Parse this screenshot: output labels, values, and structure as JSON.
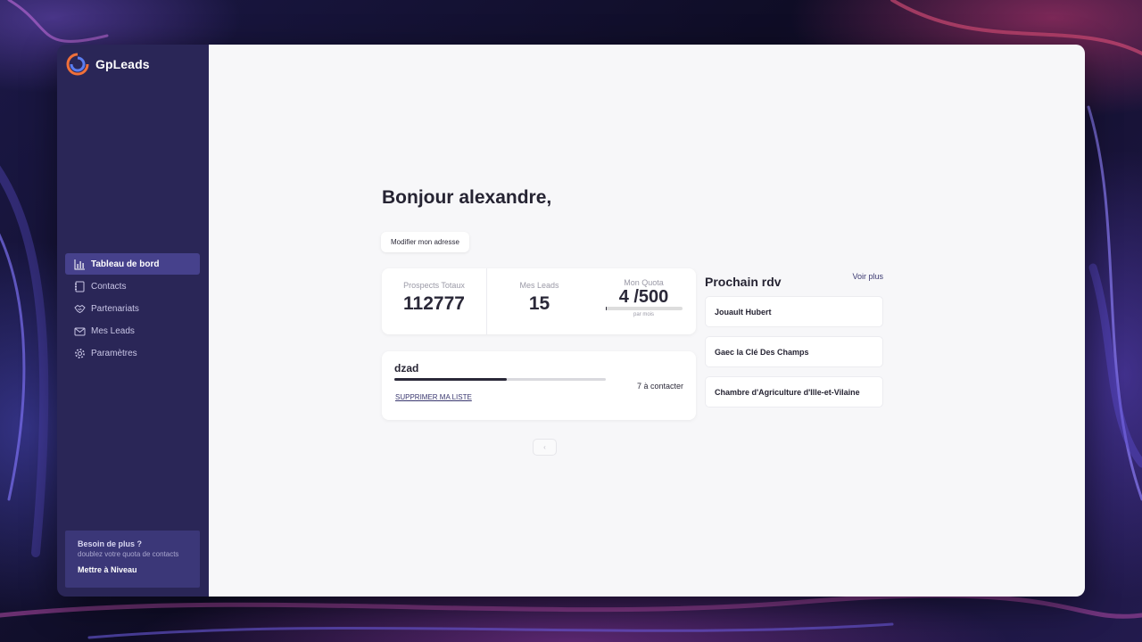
{
  "app": {
    "name": "GpLeads"
  },
  "sidebar": {
    "items": [
      {
        "label": "Tableau de bord",
        "icon": "bar-chart-icon",
        "active": true
      },
      {
        "label": "Contacts",
        "icon": "address-book-icon",
        "active": false
      },
      {
        "label": "Partenariats",
        "icon": "handshake-icon",
        "active": false
      },
      {
        "label": "Mes Leads",
        "icon": "mail-icon",
        "active": false
      },
      {
        "label": "Paramètres",
        "icon": "gear-icon",
        "active": false
      }
    ],
    "upgrade": {
      "title": "Besoin de plus ?",
      "subtitle": "doublez votre quota de contacts",
      "button": "Mettre à Niveau"
    }
  },
  "main": {
    "greeting": "Bonjour alexandre,",
    "address_button": "Modifier mon adresse",
    "stats": {
      "prospects": {
        "label": "Prospects Totaux",
        "value": "112777"
      },
      "leads": {
        "label": "Mes Leads",
        "value": "15"
      },
      "quota": {
        "label": "Mon Quota",
        "value": "4 /500",
        "subtitle": "par mois",
        "progress": 0.008
      }
    },
    "lists": [
      {
        "name": "dzad",
        "count_text": "7 à contacter",
        "delete_label": "SUPPRIMER MA LISTE",
        "progress": 0.53
      }
    ],
    "pager": {
      "label": "‹"
    },
    "rdv": {
      "title": "Prochain rdv",
      "more_label": "Voir plus",
      "items": [
        "Jouault Hubert",
        "Gaec la Clé Des Champs",
        "Chambre d'Agriculture d'Ille-et-Vilaine"
      ]
    }
  },
  "colors": {
    "sidebar_bg": "#2a2657",
    "sidebar_active": "#46418c",
    "main_bg": "#f7f7f9",
    "accent_dark": "#2a2838",
    "link": "#3a3870"
  }
}
